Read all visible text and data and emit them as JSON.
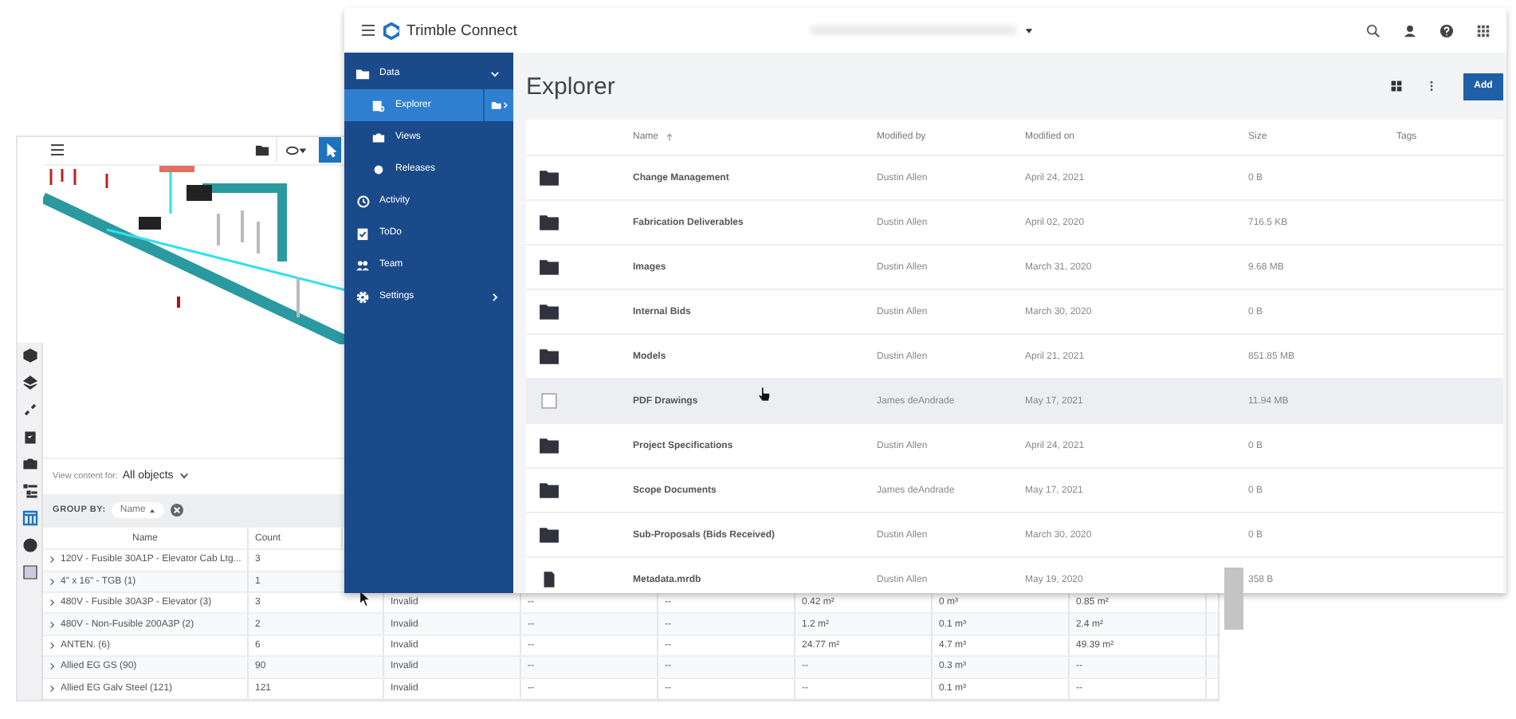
{
  "viewer": {
    "toolbar_tools": [
      {
        "selected": false
      },
      {
        "selected": false
      },
      {
        "selected": true
      }
    ],
    "rail_tools": [
      {
        "selected": false
      },
      {
        "selected": false
      },
      {
        "selected": false
      },
      {
        "selected": false
      },
      {
        "selected": false
      },
      {
        "selected": false
      },
      {
        "selected": true
      },
      {
        "selected": false
      },
      {
        "selected": false
      }
    ],
    "view_content_label": "View content for:",
    "view_content_value": "All objects",
    "group_by_label": "GROUP BY:",
    "group_by_chip": "Name",
    "table": {
      "columns": [
        "Name",
        "Count"
      ],
      "rows": [
        {
          "name": "120V - Fusible 30A1P - Elevator Cab Ltg...",
          "count": "3"
        },
        {
          "name": "4\" x 16\" - TGB (1)",
          "count": "1"
        },
        {
          "name": "480V - Fusible 30A3P - Elevator (3)",
          "count": "3",
          "cells": [
            "Invalid",
            "--",
            "--",
            "0.42 m²",
            "0 m³",
            "0.85 m²"
          ]
        },
        {
          "name": "480V - Non-Fusible 200A3P (2)",
          "count": "2",
          "cells": [
            "Invalid",
            "--",
            "--",
            "1.2 m²",
            "0.1 m³",
            "2.4 m²"
          ]
        },
        {
          "name": "ANTEN. (6)",
          "count": "6",
          "cells": [
            "Invalid",
            "--",
            "--",
            "24.77 m²",
            "4.7 m³",
            "49.39 m²"
          ]
        },
        {
          "name": "Allied EG GS (90)",
          "count": "90",
          "cells": [
            "Invalid",
            "--",
            "--",
            "--",
            "0.3 m³",
            "--"
          ]
        },
        {
          "name": "Allied EG Galv Steel (121)",
          "count": "121",
          "cells": [
            "Invalid",
            "--",
            "--",
            "--",
            "0.1 m³",
            "--"
          ]
        }
      ]
    }
  },
  "connect": {
    "brand": "Trimble Connect",
    "sidebar": {
      "items": [
        {
          "label": "Data",
          "selected": false,
          "expanded": true,
          "children": [
            {
              "label": "Explorer",
              "selected": true
            },
            {
              "label": "Views",
              "selected": false
            },
            {
              "label": "Releases",
              "selected": false
            }
          ]
        },
        {
          "label": "Activity",
          "selected": false
        },
        {
          "label": "ToDo",
          "selected": false
        },
        {
          "label": "Team",
          "selected": false
        },
        {
          "label": "Settings",
          "selected": false,
          "expanded": false
        }
      ]
    },
    "page_title": "Explorer",
    "add_button": "Add",
    "table": {
      "columns": [
        "Name",
        "Modified by",
        "Modified on",
        "Size",
        "Tags"
      ],
      "rows": [
        {
          "kind": "folder",
          "hovered": false,
          "name": "Change Management",
          "modified_by": "Dustin Allen",
          "modified_on": "April 24, 2021",
          "size": "0 B"
        },
        {
          "kind": "folder",
          "hovered": false,
          "name": "Fabrication Deliverables",
          "modified_by": "Dustin Allen",
          "modified_on": "April 02, 2020",
          "size": "716.5 KB"
        },
        {
          "kind": "folder",
          "hovered": false,
          "name": "Images",
          "modified_by": "Dustin Allen",
          "modified_on": "March 31, 2020",
          "size": "9.68 MB"
        },
        {
          "kind": "folder",
          "hovered": false,
          "name": "Internal Bids",
          "modified_by": "Dustin Allen",
          "modified_on": "March 30, 2020",
          "size": "0 B"
        },
        {
          "kind": "folder",
          "hovered": false,
          "name": "Models",
          "modified_by": "Dustin Allen",
          "modified_on": "April 21, 2021",
          "size": "851.85 MB"
        },
        {
          "hovered": true,
          "name": "PDF Drawings",
          "modified_by": "James deAndrade",
          "modified_on": "May 17, 2021",
          "size": "11.94 MB"
        },
        {
          "kind": "folder",
          "hovered": false,
          "name": "Project Specifications",
          "modified_by": "Dustin Allen",
          "modified_on": "April 24, 2021",
          "size": "0 B"
        },
        {
          "kind": "folder",
          "hovered": false,
          "name": "Scope Documents",
          "modified_by": "James deAndrade",
          "modified_on": "May 17, 2021",
          "size": "0 B"
        },
        {
          "kind": "folder",
          "hovered": false,
          "name": "Sub-Proposals (Bids Received)",
          "modified_by": "Dustin Allen",
          "modified_on": "March 30, 2020",
          "size": "0 B"
        },
        {
          "kind": "file",
          "hovered": false,
          "name": "Metadata.mrdb",
          "modified_by": "Dustin Allen",
          "modified_on": "May 19, 2020",
          "size": "358 B"
        }
      ]
    }
  }
}
